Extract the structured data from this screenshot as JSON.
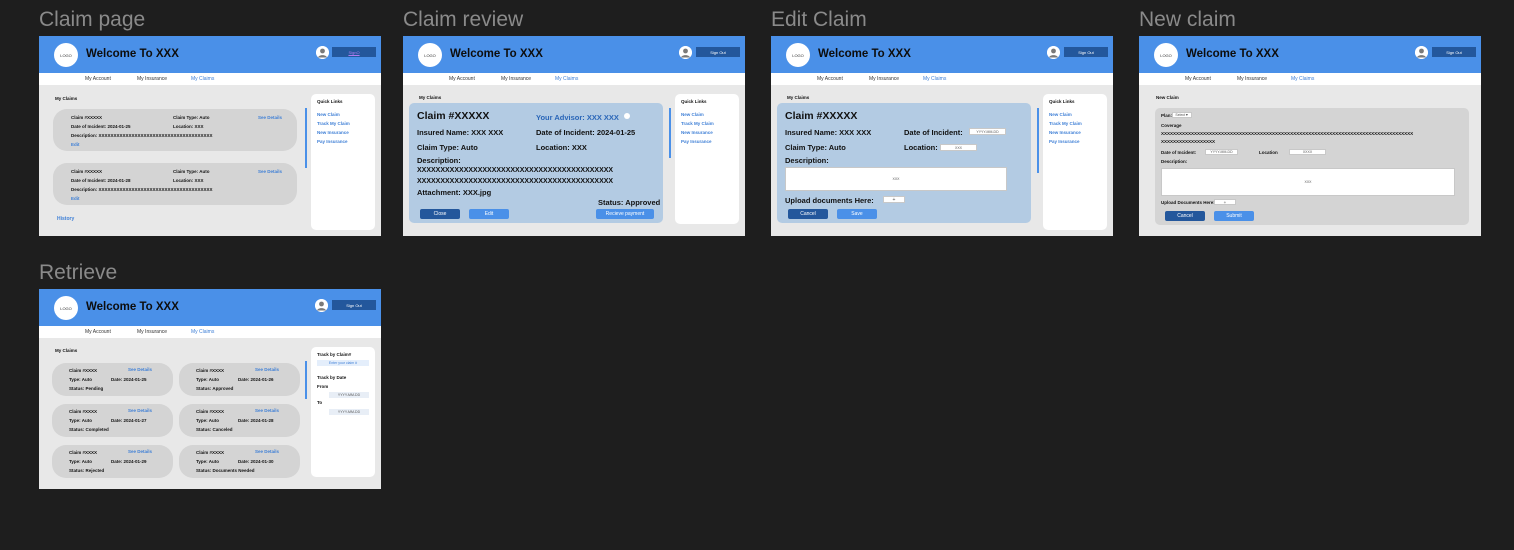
{
  "frames": {
    "claim_page": "Claim page",
    "claim_review": "Claim review",
    "edit_claim": "Edit Claim",
    "new_claim": "New claim",
    "retrieve": "Retrieve"
  },
  "common": {
    "logo": "LOGO",
    "welcome": "Welcome To XXX",
    "sign_out": "Sign Out",
    "nav": [
      "My Account",
      "My Insurance",
      "My Claims"
    ],
    "my_claims": "My Claims",
    "see_details": "See Details",
    "quick_links_title": "Quick Links",
    "quick_links": [
      "New Claim",
      "Track My Claim",
      "New Insurance",
      "Pay Insurance"
    ]
  },
  "claim_page": {
    "signout_label": "SignO",
    "claims": [
      {
        "id": "Claim #XXXXX",
        "type": "Claim Type: Auto",
        "date": "Date of Incident: 2024-01-25",
        "location": "Location: XXX",
        "description": "Description: XXXXXXXXXXXXXXXXXXXXXXXXXXXXXXXXXXXXXX",
        "edit": "Edit"
      },
      {
        "id": "Claim #XXXXX",
        "type": "Claim Type: Auto",
        "date": "Date of Incident: 2024-01-28",
        "location": "Location: XXX",
        "description": "Description: XXXXXXXXXXXXXXXXXXXXXXXXXXXXXXXXXXXXXX",
        "edit": "Edit"
      }
    ],
    "history": "History"
  },
  "claim_review": {
    "signout_label": "Sign Out",
    "claim_id": "Claim #XXXXX",
    "advisor": "Your Advisor: XXX XXX",
    "insured": "Insured Name: XXX XXX",
    "date": "Date of  Incident: 2024-01-25",
    "type": "Claim Type: Auto",
    "location": "Location: XXX",
    "description_label": "Description:",
    "description_line1": "XXXXXXXXXXXXXXXXXXXXXXXXXXXXXXXXXXXXXXXXXX",
    "description_line2": "XXXXXXXXXXXXXXXXXXXXXXXXXXXXXXXXXXXXXXXXXX",
    "attachment": "Attachment: XXX.jpg",
    "status": "Status: Approved",
    "close": "Close",
    "edit": "Edit",
    "receive": "Recieve payment"
  },
  "edit_claim": {
    "claim_id": "Claim #XXXXX",
    "insured": "Insured Name: XXX XXX",
    "date_label": "Date of  Incident:",
    "date_placeholder": "YYYY-MM-DD",
    "type": "Claim Type: Auto",
    "location_label": "Location:",
    "location_value": "XXX",
    "description_label": "Description:",
    "description_value": "XXX",
    "upload_label": "Upload documents Here:",
    "upload_button": "+",
    "cancel": "Cancel",
    "save": "Save"
  },
  "new_claim": {
    "title": "New Claim",
    "plan_label": "Plan:",
    "plan_select": "Select▼",
    "coverage_label": "Coverage",
    "coverage_line1": "XXXXXXXXXXXXXXXXXXXXXXXXXXXXXXXXXXXXXXXXXXXXXXXXXXXXXXXXXXXXXXXXXXXXXXXXXXXXXXXXXXXX",
    "coverage_line2": "XXXXXXXXXXXXXXXXXX",
    "date_label": "Date of Incident:",
    "date_placeholder": "YYYY-MM-DD",
    "location_label": "Location",
    "location_value": "XXXX",
    "description_label": "Description:",
    "description_value": "XXX",
    "upload_label": "Upload Documents Here:",
    "upload_button": "+",
    "cancel": "Cancel",
    "submit": "Submit"
  },
  "retrieve": {
    "track_claim_title": "Track by Claim#",
    "track_claim_placeholder": "Enter your claim #",
    "track_date_title": "Track by Date",
    "from_label": "From",
    "to_label": "To",
    "date_placeholder": "YYYY-MM-DD",
    "claims": [
      {
        "id": "Claim #XXXX",
        "type": "Type: Auto",
        "date": "Date: 2024-01-25",
        "status": "Status: Pending"
      },
      {
        "id": "Claim #XXXX",
        "type": "Type: Auto",
        "date": "Date: 2024-01-26",
        "status": "Status: Approved"
      },
      {
        "id": "Claim #XXXX",
        "type": "Type: Auto",
        "date": "Date: 2024-01-27",
        "status": "Status: Completed"
      },
      {
        "id": "Claim #XXXX",
        "type": "Type: Auto",
        "date": "Date: 2024-01-28",
        "status": "Status: Canceled"
      },
      {
        "id": "Claim #XXXX",
        "type": "Type: Auto",
        "date": "Date: 2024-01-29",
        "status": "Status: Rejected"
      },
      {
        "id": "Claim #XXXX",
        "type": "Type: Auto",
        "date": "Date: 2024-01-30",
        "status": "Status: Documents Needed"
      }
    ]
  }
}
